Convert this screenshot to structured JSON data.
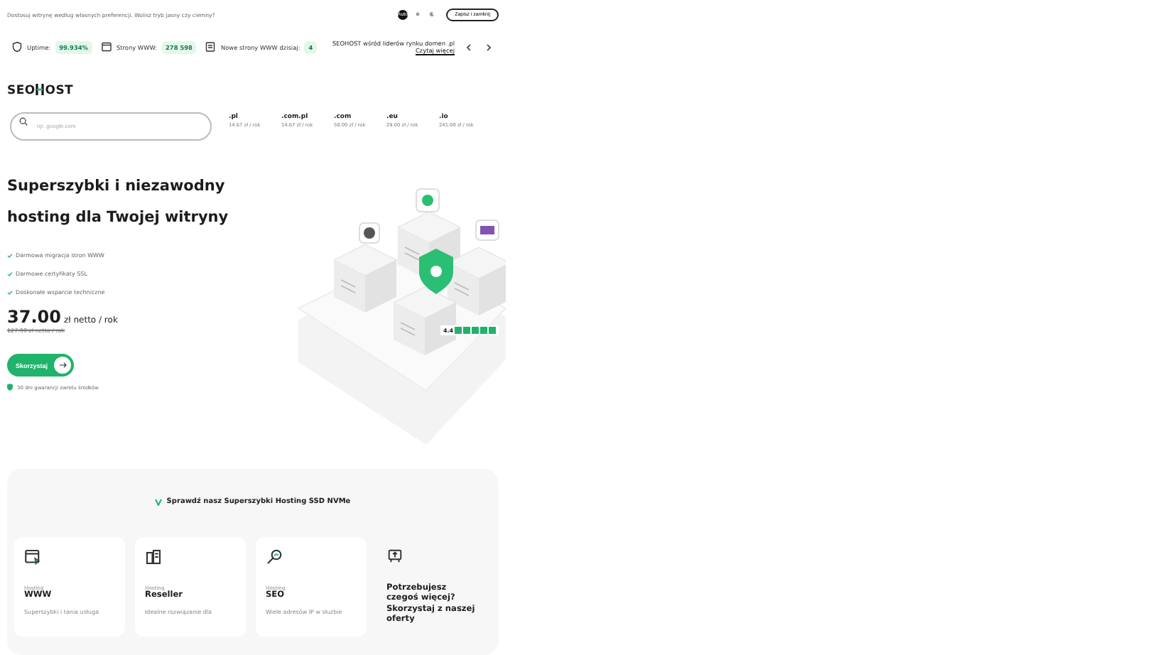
{
  "top_bar": {
    "message": "Dostosuj witrynę według własnych preferencji. Wolisz tryb jasny czy ciemny?",
    "theme_options": [
      {
        "kind": "text",
        "label": "Auto",
        "selected": true
      },
      {
        "kind": "sun",
        "selected": false
      },
      {
        "kind": "moon",
        "selected": false
      }
    ],
    "save_button": "Zapisz i zamknij"
  },
  "stats": [
    {
      "kind": "shield",
      "label": "Uptime:",
      "value": "99.934%"
    },
    {
      "kind": "browser",
      "label": "Strony WWW:",
      "value": "278 598"
    },
    {
      "kind": "document",
      "label": "Nowe strony WWW dzisiaj:",
      "value": "4"
    }
  ],
  "news": {
    "text": "SEOHOST wśród liderów rynku domen .pl",
    "link": "Czytaj więcej"
  },
  "logo": {
    "before": "SEO",
    "after": "OST"
  },
  "domain_search": {
    "placeholder": "np. google.com"
  },
  "domains": [
    {
      "name": ".pl",
      "price": "14.67 zł / rok"
    },
    {
      "name": ".com.pl",
      "price": "14.67 zł / rok"
    },
    {
      "name": ".com",
      "price": "59.00 zł / rok"
    },
    {
      "name": ".eu",
      "price": "29.00 zł / rok"
    },
    {
      "name": ".io",
      "price": "241.00 zł / rok"
    }
  ],
  "hero": {
    "title_line_1": "Superszybki i niezawodny",
    "title_line_2": "hosting dla Twojej witryny",
    "features": [
      "Darmowa migracja stron WWW",
      "Darmowe certyfikaty SSL",
      "Doskonałe wsparcie techniczne"
    ],
    "price": "37.00",
    "price_unit": "zł netto / rok",
    "old_price": "127.00 zł netto / rok",
    "cta": "Skorzystaj",
    "guarantee": "30 dni gwarancji zwrotu środków",
    "rating": "4.4",
    "stars": 5
  },
  "offers": {
    "heading": "Sprawdź nasz Superszybki Hosting SSD NVMe",
    "cards": [
      {
        "kind": "browser",
        "category": "Hosting",
        "title": "WWW",
        "description": "Superszybki i tania usługa"
      },
      {
        "kind": "servers",
        "category": "Hosting",
        "title": "Reseller",
        "description": "Idealne rozwiązanie dla"
      },
      {
        "kind": "magnifier",
        "category": "Hosting",
        "title": "SEO",
        "description": "Wiele adresów IP w służbie"
      },
      {
        "kind": "promo",
        "title": "Potrzebujesz czegoś więcej? Skorzystaj z naszej oferty"
      }
    ]
  }
}
